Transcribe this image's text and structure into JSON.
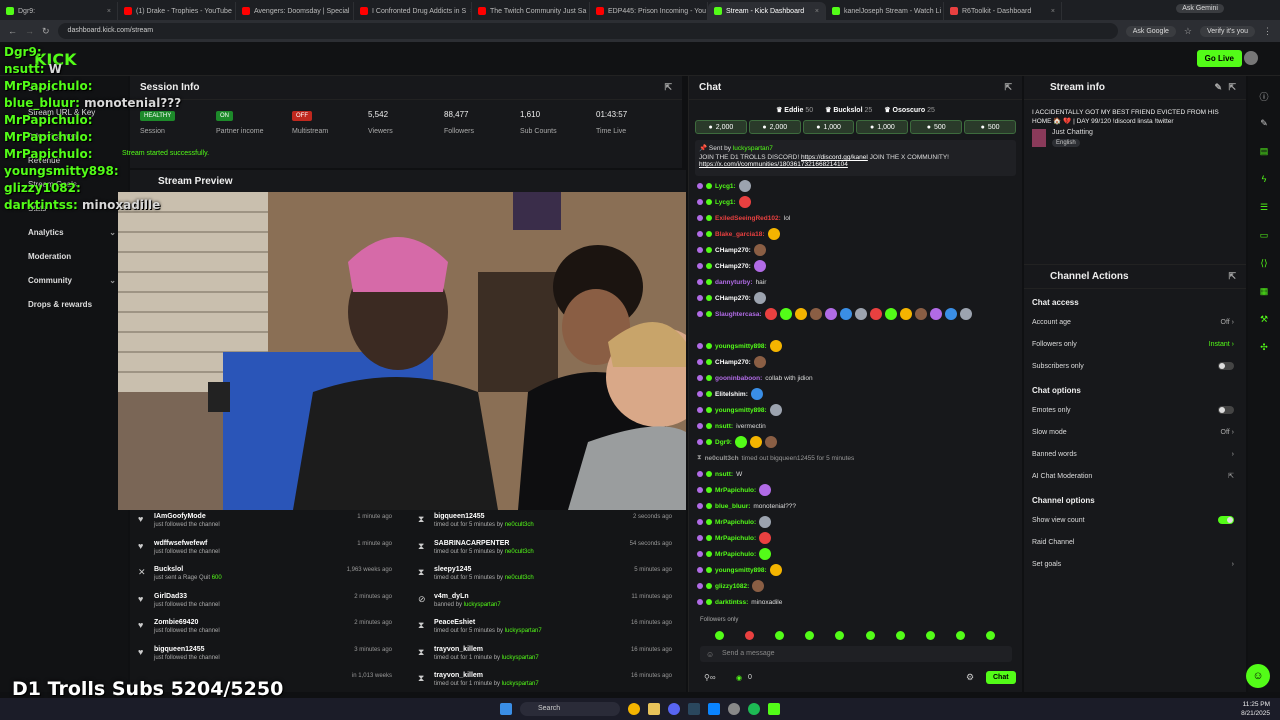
{
  "tabs": [
    {
      "label": "Dgr9:",
      "active": false,
      "fav": "#53fc18"
    },
    {
      "label": "(1) Drake - Trophies - YouTube",
      "active": false,
      "fav": "#ff0000"
    },
    {
      "label": "Avengers: Doomsday | Special",
      "active": false,
      "fav": "#ff0000"
    },
    {
      "label": "I Confronted Drug Addicts in S",
      "active": false,
      "fav": "#ff0000"
    },
    {
      "label": "The Twitch Community Just Sa",
      "active": false,
      "fav": "#ff0000"
    },
    {
      "label": "EDP445: Prison Incoming - You",
      "active": false,
      "fav": "#ff0000"
    },
    {
      "label": "Stream - Kick Dashboard",
      "active": true,
      "fav": "#53fc18"
    },
    {
      "label": "kanelJoseph Stream - Watch Li",
      "active": false,
      "fav": "#53fc18"
    },
    {
      "label": "R6Toolkit - Dashboard",
      "active": false,
      "fav": "#e94040"
    }
  ],
  "browser": {
    "url": "dashboard.kick.com/stream",
    "ask_gemini": "Ask Gemini",
    "ask_google": "Ask Google",
    "verify": "Verify it's you"
  },
  "overlay": [
    {
      "user": "Dgr9:",
      "text": "",
      "color": "#53fc18"
    },
    {
      "user": "nsutt:",
      "text": "W",
      "color": "#53fc18"
    },
    {
      "user": "MrPapichulo:",
      "text": "",
      "color": "#53fc18"
    },
    {
      "user": "blue_bluur:",
      "text": "monotenial???",
      "color": "#53fc18"
    },
    {
      "user": "MrPapichulo:",
      "text": "",
      "color": "#53fc18"
    },
    {
      "user": "MrPapichulo:",
      "text": "",
      "color": "#53fc18"
    },
    {
      "user": "MrPapichulo:",
      "text": "",
      "color": "#53fc18"
    },
    {
      "user": "youngsmitty898:",
      "text": "",
      "color": "#53fc18"
    },
    {
      "user": "glizzy1082:",
      "text": "",
      "color": "#53fc18"
    },
    {
      "user": "darktintss:",
      "text": "minoxadille",
      "color": "#53fc18"
    }
  ],
  "sidebar": {
    "items": [
      {
        "label": "Stream",
        "chev": ""
      },
      {
        "label": "Stream URL & Key",
        "chev": ""
      },
      {
        "label": "Advertisement",
        "chev": ""
      },
      {
        "label": "Revenue",
        "chev": ""
      },
      {
        "label": "Stream Goals",
        "chev": ""
      },
      {
        "label": "Stats",
        "chev": ""
      },
      {
        "label": "Analytics",
        "chev": "⌄"
      },
      {
        "label": "Moderation",
        "chev": ""
      },
      {
        "label": "Community",
        "chev": "⌄"
      },
      {
        "label": "Drops & rewards",
        "chev": ""
      }
    ]
  },
  "session": {
    "title": "Session Info",
    "stats": [
      {
        "value": "HEALTHY",
        "label": "Session",
        "badge": "#1d8a2a"
      },
      {
        "value": "ON",
        "label": "Partner income",
        "badge": "#1d8a2a"
      },
      {
        "value": "OFF",
        "label": "Multistream",
        "badge": "#c0281e"
      },
      {
        "value": "5,542",
        "label": "Viewers",
        "badge": ""
      },
      {
        "value": "88,477",
        "label": "Followers",
        "badge": ""
      },
      {
        "value": "1,610",
        "label": "Sub Counts",
        "badge": ""
      },
      {
        "value": "01:43:57",
        "label": "Time Live",
        "badge": ""
      }
    ],
    "toast": "Stream started successfully."
  },
  "preview": {
    "title": "Stream Preview"
  },
  "logs_left": [
    {
      "icon": "♥",
      "name": "IAmGoofyMode",
      "sub": "just followed the channel",
      "time": "1 minute ago",
      "by": ""
    },
    {
      "icon": "♥",
      "name": "wdffwsefwefewf",
      "sub": "just followed the channel",
      "time": "1 minute ago",
      "by": ""
    },
    {
      "icon": "✕",
      "name": "Buckslol",
      "sub": "just sent a Rage Quit",
      "time": "1,963 weeks ago",
      "by": "600"
    },
    {
      "icon": "♥",
      "name": "GirlDad33",
      "sub": "just followed the channel",
      "time": "2 minutes ago",
      "by": ""
    },
    {
      "icon": "♥",
      "name": "Zombie69420",
      "sub": "just followed the channel",
      "time": "2 minutes ago",
      "by": ""
    },
    {
      "icon": "♥",
      "name": "bigqueen12455",
      "sub": "just followed the channel",
      "time": "3 minutes ago",
      "by": ""
    },
    {
      "icon": "",
      "name": "",
      "sub": "",
      "time": "in 1,013 weeks",
      "by": ""
    }
  ],
  "logs_right": [
    {
      "icon": "⧗",
      "name": "bigqueen12455",
      "sub": "timed out for 5 minutes by",
      "by": "ne0cult3ch",
      "time": "2 seconds ago"
    },
    {
      "icon": "⧗",
      "name": "SABRINACARPENTER",
      "sub": "timed out for 5 minutes by",
      "by": "ne0cult3ch",
      "time": "54 seconds ago"
    },
    {
      "icon": "⧗",
      "name": "sleepy1245",
      "sub": "timed out for 5 minutes by",
      "by": "ne0cult3ch",
      "time": "5 minutes ago"
    },
    {
      "icon": "⊘",
      "name": "v4m_dyLn",
      "sub": "banned by",
      "by": "luckyspartan7",
      "time": "11 minutes ago"
    },
    {
      "icon": "⧗",
      "name": "PeaceEshiet",
      "sub": "timed out for 5 minutes by",
      "by": "luckyspartan7",
      "time": "16 minutes ago"
    },
    {
      "icon": "⧗",
      "name": "trayvon_killem",
      "sub": "timed out for 1 minute by",
      "by": "luckyspartan7",
      "time": "16 minutes ago"
    },
    {
      "icon": "⧗",
      "name": "trayvon_killem",
      "sub": "timed out for 1 minute by",
      "by": "luckyspartan7",
      "time": "16 minutes ago"
    }
  ],
  "chat": {
    "title": "Chat",
    "gifters": [
      {
        "name": "Eddie",
        "count": "50"
      },
      {
        "name": "Buckslol",
        "count": "25"
      },
      {
        "name": "Ososcuro",
        "count": "25"
      }
    ],
    "subs": [
      "2,000",
      "2,000",
      "1,000",
      "1,000",
      "500",
      "500"
    ],
    "pinned": {
      "sent_by": "Sent by",
      "user": "luckyspartan7",
      "text1": "JOIN THE D1 TROLLS DISCORD!",
      "link1": "https://discord.gg/kanel",
      "text2": "JOIN THE X COMMUNITY!",
      "link2": "https://x.com/i/communities/1803617321668214104"
    },
    "messages": [
      {
        "user": "Lycg1:",
        "text": "",
        "color": "#53fc18",
        "emotes": 1,
        "sys": false
      },
      {
        "user": "Lycg1:",
        "text": "",
        "color": "#53fc18",
        "emotes": 1,
        "sys": false
      },
      {
        "user": "ExiledSeeingRed102:",
        "text": "lol",
        "color": "#e94040",
        "emotes": 0,
        "sys": false
      },
      {
        "user": "Blake_garcia18:",
        "text": "",
        "color": "#e94040",
        "emotes": 1,
        "sys": false
      },
      {
        "user": "CHamp270:",
        "text": "",
        "color": "#ffffff",
        "emotes": 1,
        "sys": false
      },
      {
        "user": "CHamp270:",
        "text": "",
        "color": "#ffffff",
        "emotes": 1,
        "sys": false
      },
      {
        "user": "dannyturby:",
        "text": "hair",
        "color": "#b16be6",
        "emotes": 0,
        "sys": false
      },
      {
        "user": "CHamp270:",
        "text": "",
        "color": "#ffffff",
        "emotes": 1,
        "sys": false
      },
      {
        "user": "Slaughtercasa:",
        "text": "",
        "color": "#b16be6",
        "emotes": 14,
        "sys": false
      },
      {
        "user": "",
        "text": "",
        "color": "#ffffff",
        "emotes": 0,
        "sys": false
      },
      {
        "user": "youngsmitty898:",
        "text": "",
        "color": "#53fc18",
        "emotes": 1,
        "sys": false
      },
      {
        "user": "CHamp270:",
        "text": "",
        "color": "#ffffff",
        "emotes": 1,
        "sys": false
      },
      {
        "user": "gooninbaboon:",
        "text": "collab with jidion",
        "color": "#b16be6",
        "emotes": 0,
        "sys": false
      },
      {
        "user": "Elitelshim:",
        "text": "",
        "color": "#ffffff",
        "emotes": 1,
        "sys": false
      },
      {
        "user": "youngsmitty898:",
        "text": "",
        "color": "#53fc18",
        "emotes": 1,
        "sys": false
      },
      {
        "user": "nsutt:",
        "text": "ivermectin",
        "color": "#53fc18",
        "emotes": 0,
        "sys": false
      },
      {
        "user": "Dgr9:",
        "text": "",
        "color": "#53fc18",
        "emotes": 3,
        "sys": false
      },
      {
        "user": "ne0cult3ch",
        "text": "timed out bigqueen12455 for 5 minutes",
        "color": "#999999",
        "emotes": 0,
        "sys": true
      },
      {
        "user": "nsutt:",
        "text": "W",
        "color": "#53fc18",
        "emotes": 0,
        "sys": false
      },
      {
        "user": "MrPapichulo:",
        "text": "",
        "color": "#53fc18",
        "emotes": 1,
        "sys": false
      },
      {
        "user": "blue_bluur:",
        "text": "monotenial???",
        "color": "#53fc18",
        "emotes": 0,
        "sys": false
      },
      {
        "user": "MrPapichulo:",
        "text": "",
        "color": "#53fc18",
        "emotes": 1,
        "sys": false
      },
      {
        "user": "MrPapichulo:",
        "text": "",
        "color": "#53fc18",
        "emotes": 1,
        "sys": false
      },
      {
        "user": "MrPapichulo:",
        "text": "",
        "color": "#53fc18",
        "emotes": 1,
        "sys": false
      },
      {
        "user": "youngsmitty898:",
        "text": "",
        "color": "#53fc18",
        "emotes": 1,
        "sys": false
      },
      {
        "user": "glizzy1082:",
        "text": "",
        "color": "#53fc18",
        "emotes": 1,
        "sys": false
      },
      {
        "user": "darktintss:",
        "text": "minoxadile",
        "color": "#53fc18",
        "emotes": 0,
        "sys": false
      }
    ],
    "followers_only": "Followers only",
    "input_placeholder": "Send a message",
    "count": "0",
    "send": "Chat"
  },
  "streaminfo": {
    "title": "Stream info",
    "stream_title": "I ACCIDENTALLY GOT MY BEST FRIEND EVICTED FROM HIS HOME 🏠 💔 | DAY 99/120 !discord linsta !twitter",
    "category": "Just Chatting",
    "language": "English"
  },
  "actions": {
    "title": "Channel Actions",
    "sections": [
      {
        "heading": "Chat access",
        "opts": [
          {
            "label": "Account age",
            "value": "Off",
            "kind": "chev",
            "on": false
          },
          {
            "label": "Followers only",
            "value": "Instant",
            "kind": "chev",
            "on": false
          },
          {
            "label": "Subscribers only",
            "value": "",
            "kind": "toggle",
            "on": false
          }
        ]
      },
      {
        "heading": "Chat options",
        "opts": [
          {
            "label": "Emotes only",
            "value": "",
            "kind": "toggle",
            "on": false
          },
          {
            "label": "Slow mode",
            "value": "Off",
            "kind": "chev",
            "on": false
          },
          {
            "label": "Banned words",
            "value": "",
            "kind": "chev",
            "on": false
          },
          {
            "label": "AI Chat Moderation",
            "value": "",
            "kind": "ext",
            "on": false
          }
        ]
      },
      {
        "heading": "Channel options",
        "opts": [
          {
            "label": "Show view count",
            "value": "",
            "kind": "toggle",
            "on": true
          },
          {
            "label": "Raid Channel",
            "value": "",
            "kind": "none",
            "on": false
          },
          {
            "label": "Set goals",
            "value": "",
            "kind": "chev",
            "on": false
          }
        ]
      }
    ]
  },
  "golive": "Go Live",
  "subgoal": "D1 Trolls Subs 5204/5250",
  "taskbar": {
    "search": "Search",
    "time": "11:25 PM",
    "date": "8/21/2025"
  },
  "colors": {
    "accent": "#53fc18",
    "bg": "#0f1012",
    "panel": "#17181b"
  }
}
